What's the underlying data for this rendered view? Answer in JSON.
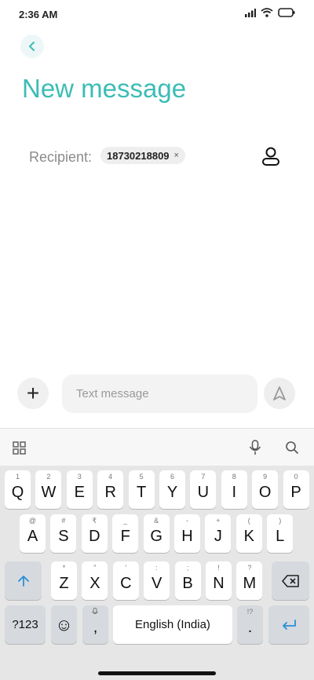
{
  "status_bar": {
    "time": "2:36 AM"
  },
  "header": {
    "title": "New message"
  },
  "recipient": {
    "label": "Recipient:",
    "number": "18730218809",
    "remove_glyph": "×"
  },
  "compose": {
    "placeholder": "Text message",
    "plus_glyph": "+"
  },
  "keyboard": {
    "toolbar_icons": [
      "grid-icon",
      "mic-icon",
      "search-icon"
    ],
    "row1": [
      {
        "hint": "1",
        "key": "Q"
      },
      {
        "hint": "2",
        "key": "W"
      },
      {
        "hint": "3",
        "key": "E"
      },
      {
        "hint": "4",
        "key": "R"
      },
      {
        "hint": "5",
        "key": "T"
      },
      {
        "hint": "6",
        "key": "Y"
      },
      {
        "hint": "7",
        "key": "U"
      },
      {
        "hint": "8",
        "key": "I"
      },
      {
        "hint": "9",
        "key": "O"
      },
      {
        "hint": "0",
        "key": "P"
      }
    ],
    "row2": [
      {
        "hint": "@",
        "key": "A"
      },
      {
        "hint": "#",
        "key": "S"
      },
      {
        "hint": "₹",
        "key": "D"
      },
      {
        "hint": "_",
        "key": "F"
      },
      {
        "hint": "&",
        "key": "G"
      },
      {
        "hint": "-",
        "key": "H"
      },
      {
        "hint": "+",
        "key": "J"
      },
      {
        "hint": "(",
        "key": "K"
      },
      {
        "hint": ")",
        "key": "L"
      }
    ],
    "row3": [
      {
        "hint": "*",
        "key": "Z"
      },
      {
        "hint": "\"",
        "key": "X"
      },
      {
        "hint": "'",
        "key": "C"
      },
      {
        "hint": ":",
        "key": "V"
      },
      {
        "hint": ";",
        "key": "B"
      },
      {
        "hint": "!",
        "key": "N"
      },
      {
        "hint": "?",
        "key": "M"
      }
    ],
    "row4": {
      "numbers": "?123",
      "emoji": "☺",
      "comma": ",",
      "space": "English (India)",
      "period": ".",
      "period_hint": "!?"
    }
  },
  "colors": {
    "accent": "#3cbcb5",
    "blue": "#2b8fd6"
  }
}
